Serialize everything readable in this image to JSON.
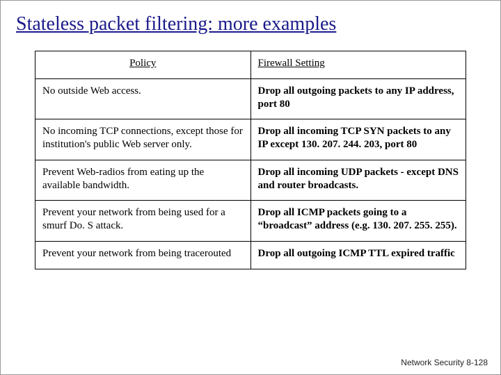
{
  "title": "Stateless packet filtering: more examples",
  "table": {
    "headers": {
      "policy": "Policy",
      "setting": "Firewall Setting"
    },
    "rows": [
      {
        "policy": "No outside Web access.",
        "setting": "Drop all outgoing packets to any IP address, port 80"
      },
      {
        "policy": "No incoming TCP connections, except those for institution's public Web server only.",
        "setting": "Drop all incoming TCP SYN packets to any IP except 130. 207. 244. 203, port 80"
      },
      {
        "policy": "Prevent Web-radios from eating up the available bandwidth.",
        "setting": "Drop all incoming UDP packets - except DNS and router broadcasts."
      },
      {
        "policy": "Prevent your network from being used for a smurf Do. S attack.",
        "setting": "Drop all ICMP packets going to a “broadcast” address (e.g. 130. 207. 255. 255)."
      },
      {
        "policy": "Prevent your network from being tracerouted",
        "setting": "Drop all outgoing ICMP TTL expired traffic"
      }
    ]
  },
  "footer": "Network Security  8-128"
}
